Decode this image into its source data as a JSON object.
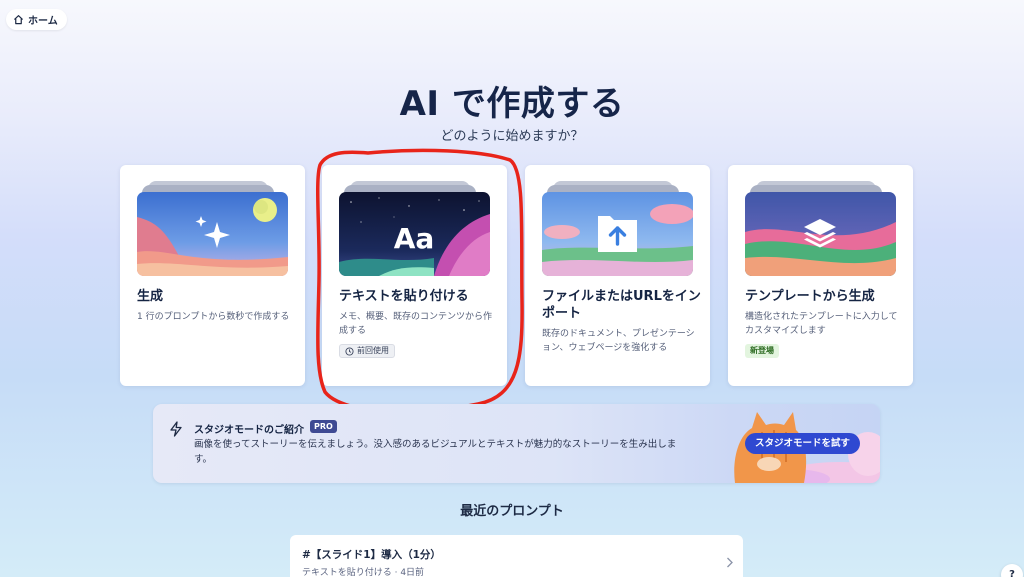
{
  "nav": {
    "home_label": "ホーム",
    "home_icon": "home-icon"
  },
  "header": {
    "title": "AI で作成する",
    "subtitle": "どのように始めますか？"
  },
  "cards": [
    {
      "title": "生成",
      "desc": "1 行のプロンプトから数秒で作成する",
      "icon": "sparkle-icon"
    },
    {
      "title": "テキストを貼り付ける",
      "desc": "メモ、概要、既存のコンテンツから作成する",
      "tag": "前回使用",
      "icon": "text-aa-icon"
    },
    {
      "title": "ファイルまたはURLをインポート",
      "desc": "既存のドキュメント、プレゼンテーション、ウェブページを強化する",
      "icon": "upload-folder-icon"
    },
    {
      "title": "テンプレートから生成",
      "desc": "構造化されたテンプレートに入力してカスタマイズします",
      "tag": "新登場",
      "icon": "layers-icon"
    }
  ],
  "studio": {
    "title": "スタジオモードのご紹介",
    "badge": "PRO",
    "description": "画像を使ってストーリーを伝えましょう。没入感のあるビジュアルとテキストが魅力的なストーリーを生み出します。",
    "button_label": "スタジオモードを試す",
    "icon": "bolt-icon"
  },
  "recent": {
    "title": "最近のプロンプト",
    "items": [
      {
        "title": "#【スライド1】導入（1分）",
        "meta": "テキストを貼り付ける · 4日前"
      }
    ]
  },
  "help_label": "?",
  "colors": {
    "accent": "#2f49d1",
    "annotation": "#e8241a",
    "title": "#162549"
  }
}
